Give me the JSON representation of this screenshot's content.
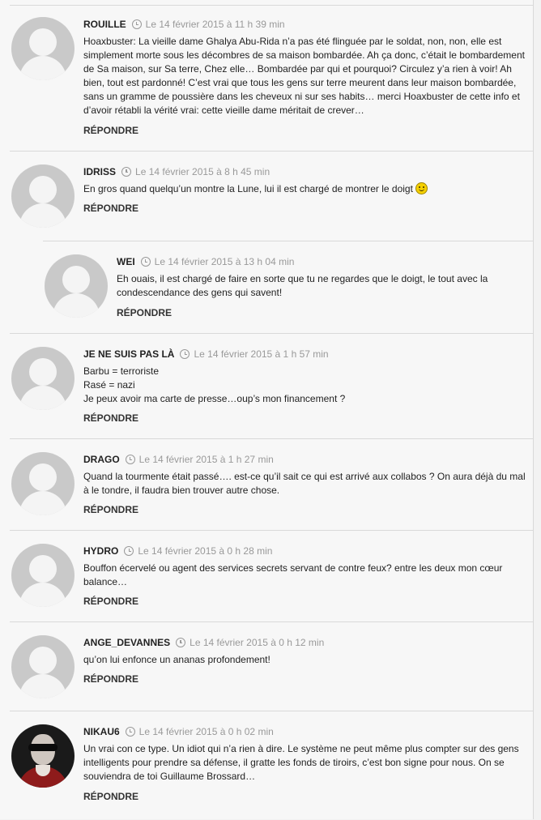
{
  "comments": [
    {
      "author": "ROUILLE",
      "date": "Le 14 février 2015 à 11 h 39 min",
      "lines": [
        "Hoaxbuster: La vieille dame Ghalya Abu-Rida n’a pas été flinguée par le soldat, non, non, elle est simplement morte sous les décombres de sa maison bombardée. Ah ça donc, c’était le bombardement de Sa maison, sur Sa terre, Chez elle… Bombardée par qui et pourquoi? Circulez y’a rien à voir! Ah bien, tout est pardonné! C’est vrai que tous les gens sur terre meurent dans leur maison bombardée, sans un gramme de poussière dans les cheveux ni sur ses habits… merci Hoaxbuster de cette info et d’avoir rétabli la vérité vrai: cette vieille dame méritait de crever…"
      ],
      "reply": "RÉPONDRE"
    },
    {
      "author": "IDRISS",
      "date": "Le 14 février 2015 à 8 h 45 min",
      "lines": [
        "En gros quand quelqu’un montre la Lune, lui il est chargé de montrer le doigt"
      ],
      "smiley": "smiley-icon",
      "reply": "RÉPONDRE"
    },
    {
      "author": "WEI",
      "date": "Le 14 février 2015 à 13 h 04 min",
      "lines": [
        "Eh ouais, il est chargé de faire en sorte que tu ne regardes que le doigt, le tout avec la condescendance des gens qui savent!"
      ],
      "reply": "RÉPONDRE"
    },
    {
      "author": "JE NE SUIS PAS LÀ",
      "date": "Le 14 février 2015 à 1 h 57 min",
      "lines": [
        "Barbu = terroriste",
        "Rasé = nazi",
        "Je peux avoir ma carte de presse…oup’s mon financement ?"
      ],
      "reply": "RÉPONDRE"
    },
    {
      "author": "DRAGO",
      "date": "Le 14 février 2015 à 1 h 27 min",
      "lines": [
        "Quand la tourmente était passé…. est-ce qu’il sait ce qui est arrivé aux collabos ? On aura déjà du mal à le tondre, il faudra bien trouver autre chose."
      ],
      "reply": "RÉPONDRE"
    },
    {
      "author": "HYDRO",
      "date": "Le 14 février 2015 à 0 h 28 min",
      "lines": [
        "Bouffon écervelé ou agent des services secrets servant de contre feux? entre les deux mon cœur balance…"
      ],
      "reply": "RÉPONDRE"
    },
    {
      "author": "ANGE_DEVANNES",
      "date": "Le 14 février 2015 à 0 h 12 min",
      "lines": [
        "qu’on lui enfonce un ananas profondement!"
      ],
      "reply": "RÉPONDRE"
    },
    {
      "author": "NIKAU6",
      "date": "Le 14 février 2015 à 0 h 02 min",
      "lines": [
        "Un vrai con ce type. Un idiot qui n’a rien à dire. Le système ne peut même plus compter sur des gens intelligents pour prendre sa défense, il gratte les fonds de tiroirs, c’est bon signe pour nous. On se souviendra de toi Guillaume Brossard…"
      ],
      "reply": "RÉPONDRE"
    }
  ]
}
